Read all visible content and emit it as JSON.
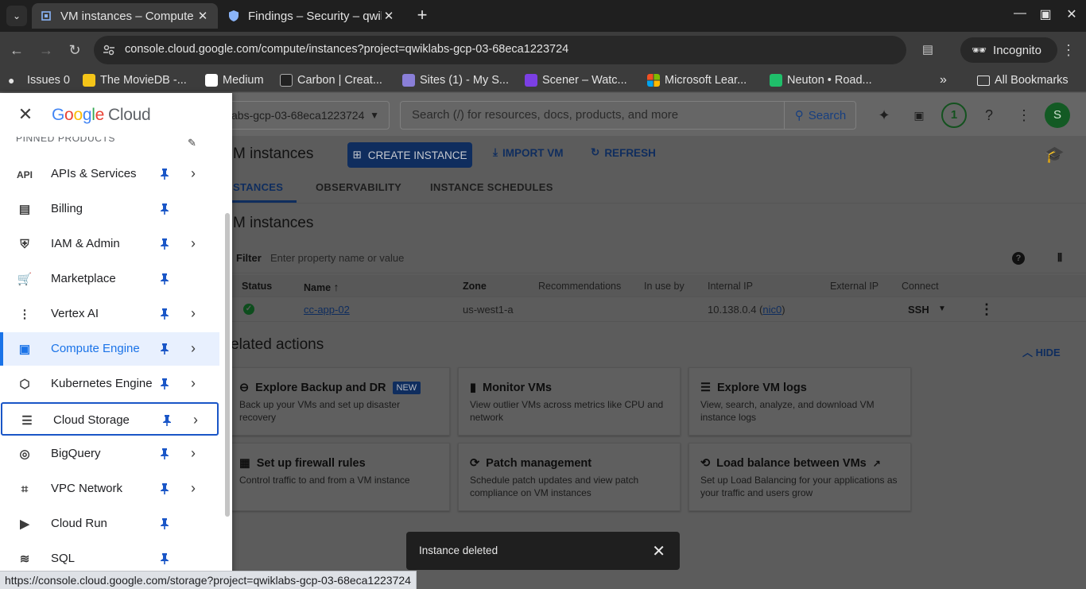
{
  "browser": {
    "tabs": [
      {
        "title": "VM instances – Compute",
        "active": true
      },
      {
        "title": "Findings – Security – qwik",
        "active": false
      }
    ],
    "url": "console.cloud.google.com/compute/instances?project=qwiklabs-gcp-03-68eca1223724",
    "incognito_label": "Incognito",
    "bookmarks": [
      {
        "label": "Issues 0",
        "color": "#e3e3e3"
      },
      {
        "label": "The MovieDB -...",
        "color": "#f5c518"
      },
      {
        "label": "Medium",
        "color": "#ffffff"
      },
      {
        "label": "Carbon | Creat...",
        "color": "#e3e3e3"
      },
      {
        "label": "Sites (1) - My S...",
        "color": "#8a7fd8"
      },
      {
        "label": "Scener – Watc...",
        "color": "#7b3fe4"
      },
      {
        "label": "Microsoft Lear...",
        "color": "#f25022"
      },
      {
        "label": "Neuton • Road...",
        "color": "#1fbf6a"
      }
    ],
    "all_bookmarks": "All Bookmarks",
    "status_url": "https://console.cloud.google.com/storage?project=qwiklabs-gcp-03-68eca1223724"
  },
  "console": {
    "project": "abs-gcp-03-68eca1223724",
    "search_placeholder": "Search (/) for resources, docs, products, and more",
    "search_btn": "Search",
    "notifications": "1",
    "avatar": "S"
  },
  "page": {
    "title": "M instances",
    "create_btn": "CREATE INSTANCE",
    "import_btn": "IMPORT VM",
    "refresh_btn": "REFRESH",
    "tabs": [
      "STANCES",
      "OBSERVABILITY",
      "INSTANCE SCHEDULES"
    ],
    "section_title": "M instances",
    "filter_label": "Filter",
    "filter_placeholder": "Enter property name or value",
    "columns": [
      "Status",
      "Name",
      "Zone",
      "Recommendations",
      "In use by",
      "Internal IP",
      "External IP",
      "Connect"
    ],
    "rows": [
      {
        "name": "cc-app-02",
        "zone": "us-west1-a",
        "internal_ip": "10.138.0.4 (",
        "nic": "nic0",
        "ip_close": ")",
        "connect": "SSH"
      }
    ],
    "related_title": "elated actions",
    "hide": "HIDE",
    "cards": [
      {
        "title": "Explore Backup and DR",
        "badge": "NEW",
        "desc": "Back up your VMs and set up disaster recovery",
        "icon": "backup-icon"
      },
      {
        "title": "Monitor VMs",
        "desc": "View outlier VMs across metrics like CPU and network",
        "icon": "chart-icon"
      },
      {
        "title": "Explore VM logs",
        "desc": "View, search, analyze, and download VM instance logs",
        "icon": "logs-icon"
      },
      {
        "title": "Set up firewall rules",
        "desc": "Control traffic to and from a VM instance",
        "icon": "firewall-icon"
      },
      {
        "title": "Patch management",
        "desc": "Schedule patch updates and view patch compliance on VM instances",
        "icon": "patch-icon"
      },
      {
        "title": "Load balance between VMs",
        "desc": "Set up Load Balancing for your applications as your traffic and users grow",
        "icon": "load-balance-icon"
      }
    ],
    "snackbar": "Instance deleted"
  },
  "drawer": {
    "logo_google": "Google",
    "logo_cloud": "Cloud",
    "pinned_header": "PINNED PRODUCTS",
    "items": [
      {
        "label": "APIs & Services",
        "icon": "API",
        "chevron": true
      },
      {
        "label": "Billing",
        "icon": "▤",
        "chevron": false
      },
      {
        "label": "IAM & Admin",
        "icon": "⛨",
        "chevron": true
      },
      {
        "label": "Marketplace",
        "icon": "🛒",
        "chevron": false
      },
      {
        "label": "Vertex AI",
        "icon": "⋮",
        "chevron": true
      },
      {
        "label": "Compute Engine",
        "icon": "▣",
        "chevron": true
      },
      {
        "label": "Kubernetes Engine",
        "icon": "⬡",
        "chevron": true
      },
      {
        "label": "Cloud Storage",
        "icon": "☰",
        "chevron": true
      },
      {
        "label": "BigQuery",
        "icon": "◎",
        "chevron": true
      },
      {
        "label": "VPC Network",
        "icon": "⌗",
        "chevron": true
      },
      {
        "label": "Cloud Run",
        "icon": "▶",
        "chevron": false
      },
      {
        "label": "SQL",
        "icon": "≋",
        "chevron": false
      }
    ]
  }
}
